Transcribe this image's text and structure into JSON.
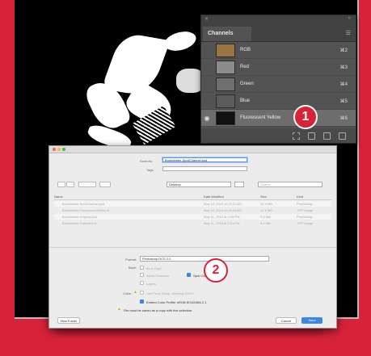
{
  "channels_panel": {
    "tab_label": "Channels",
    "menu_icon": "panel-menu-icon",
    "channels": [
      {
        "name": "RGB",
        "shortcut": "⌘2",
        "thumb_color": "#9a7443",
        "selected": false,
        "visible": false
      },
      {
        "name": "Red",
        "shortcut": "⌘3",
        "thumb_color": "#8c8c8c",
        "selected": false,
        "visible": false
      },
      {
        "name": "Green",
        "shortcut": "⌘4",
        "thumb_color": "#6f6f6f",
        "selected": false,
        "visible": false
      },
      {
        "name": "Blue",
        "shortcut": "⌘5",
        "thumb_color": "#5c5c5c",
        "selected": false,
        "visible": false
      },
      {
        "name": "Fluorescent Yellow",
        "shortcut": "⌘6",
        "thumb_color": "#111111",
        "selected": true,
        "visible": true
      }
    ]
  },
  "callouts": {
    "one": "1",
    "two": "2"
  },
  "save_dialog": {
    "save_as_label": "Save As:",
    "save_as_value": "Bumblebee-SpotChannel.psd",
    "tags_label": "Tags:",
    "location": "Desktop",
    "search_placeholder": "Search",
    "columns": {
      "name": "Name",
      "date": "Date Modified",
      "size": "Size",
      "kind": "Kind"
    },
    "files": [
      {
        "name": "Bumblebee-SpotChannel.psd",
        "date": "May 12, 2019 at 10:22 AM",
        "size": "16.3 MB",
        "kind": "Photoshop"
      },
      {
        "name": "Bumblebee-FluorescentYellow.tif",
        "date": "May 12, 2019 at 10:18 AM",
        "size": "12.1 MB",
        "kind": "TIFF image"
      },
      {
        "name": "Bumblebee-Original.psd",
        "date": "May 11, 2019 at 4:05 PM",
        "size": "9.8 MB",
        "kind": "Photoshop"
      },
      {
        "name": "Bumblebee-Flattened.tif",
        "date": "May 11, 2019 at 3:51 PM",
        "size": "8.4 MB",
        "kind": "TIFF image"
      }
    ],
    "format_label": "Format:",
    "format_value": "Photoshop DCS 2.0",
    "save_label": "Save:",
    "opt_copy": "As a Copy",
    "opt_alpha": "Alpha Channels",
    "opt_spot": "Spot Colors",
    "opt_layers": "Layers",
    "color_label": "Color:",
    "opt_proof": "Use Proof Setup: Working CMYK",
    "opt_icc": "Embed Color Profile: sRGB IEC61966-2.1",
    "warning_text": "File must be saved as a copy with this selection.",
    "new_folder": "New Folder",
    "cancel": "Cancel",
    "save": "Save"
  }
}
